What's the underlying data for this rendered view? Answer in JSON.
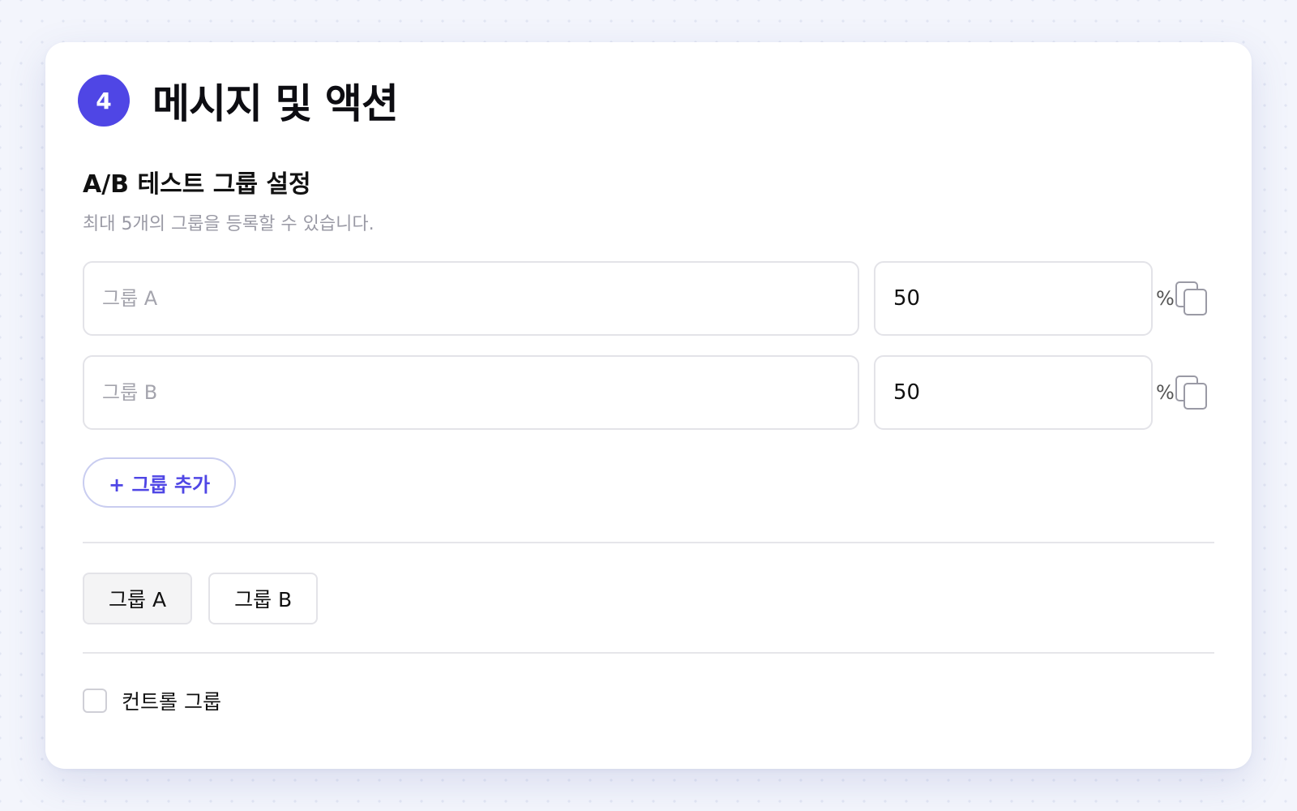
{
  "step": {
    "number": "4",
    "title": "메시지 및 액션"
  },
  "ab_test": {
    "title": "A/B 테스트 그룹 설정",
    "description": "최대 5개의 그룹을 등록할 수 있습니다.",
    "groups": [
      {
        "name_placeholder": "그룹 A",
        "name_value": "",
        "percent": "50",
        "percent_suffix": "%",
        "copy_icon": "copy-icon"
      },
      {
        "name_placeholder": "그룹 B",
        "name_value": "",
        "percent": "50",
        "percent_suffix": "%",
        "copy_icon": "copy-icon"
      }
    ],
    "add_button_label": "+ 그룹 추가"
  },
  "tabs": [
    {
      "label": "그룹 A",
      "active": true
    },
    {
      "label": "그룹 B",
      "active": false
    }
  ],
  "control_group": {
    "label": "컨트롤 그룹",
    "checked": false
  },
  "colors": {
    "accent": "#4f46e5",
    "border": "#e3e3e8",
    "muted_text": "#9a9aa5",
    "background": "#f3f5fc"
  }
}
